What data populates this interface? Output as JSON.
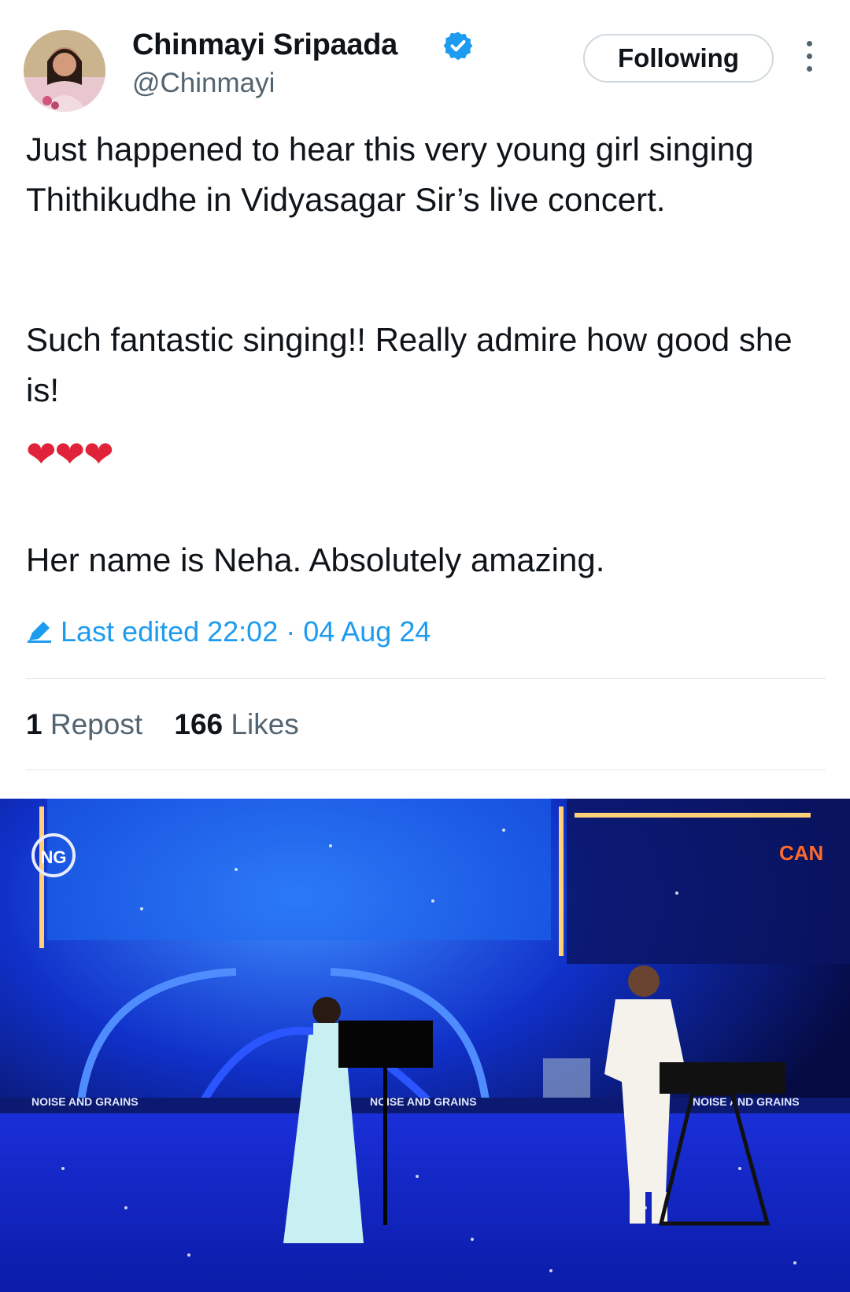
{
  "tweet": {
    "author_name": "Chinmayi Sripaada",
    "author_handle": "@Chinmayi",
    "follow_label": "Following",
    "paragraphs": [
      "Just happened to hear this very young girl singing Thithikudhe in Vidyasagar Sir’s live concert.",
      "Such fantastic singing!!  Really admire how good she is!",
      "Her name is Neha. Absolutely amazing."
    ],
    "hearts": "❤❤❤",
    "edited_label": "Last edited 22:02 · 04 Aug 24",
    "reposts_count": "1",
    "reposts_label": "Repost",
    "likes_count": "166",
    "likes_label": "Likes"
  },
  "media": {
    "logo_text": "NG",
    "watermark": "NOISE AND GRAINS",
    "channel_logo": "CAN"
  },
  "colors": {
    "accent": "#1d9bf0",
    "heart": "#e0223a",
    "stage_blue": "#1a3cff"
  }
}
